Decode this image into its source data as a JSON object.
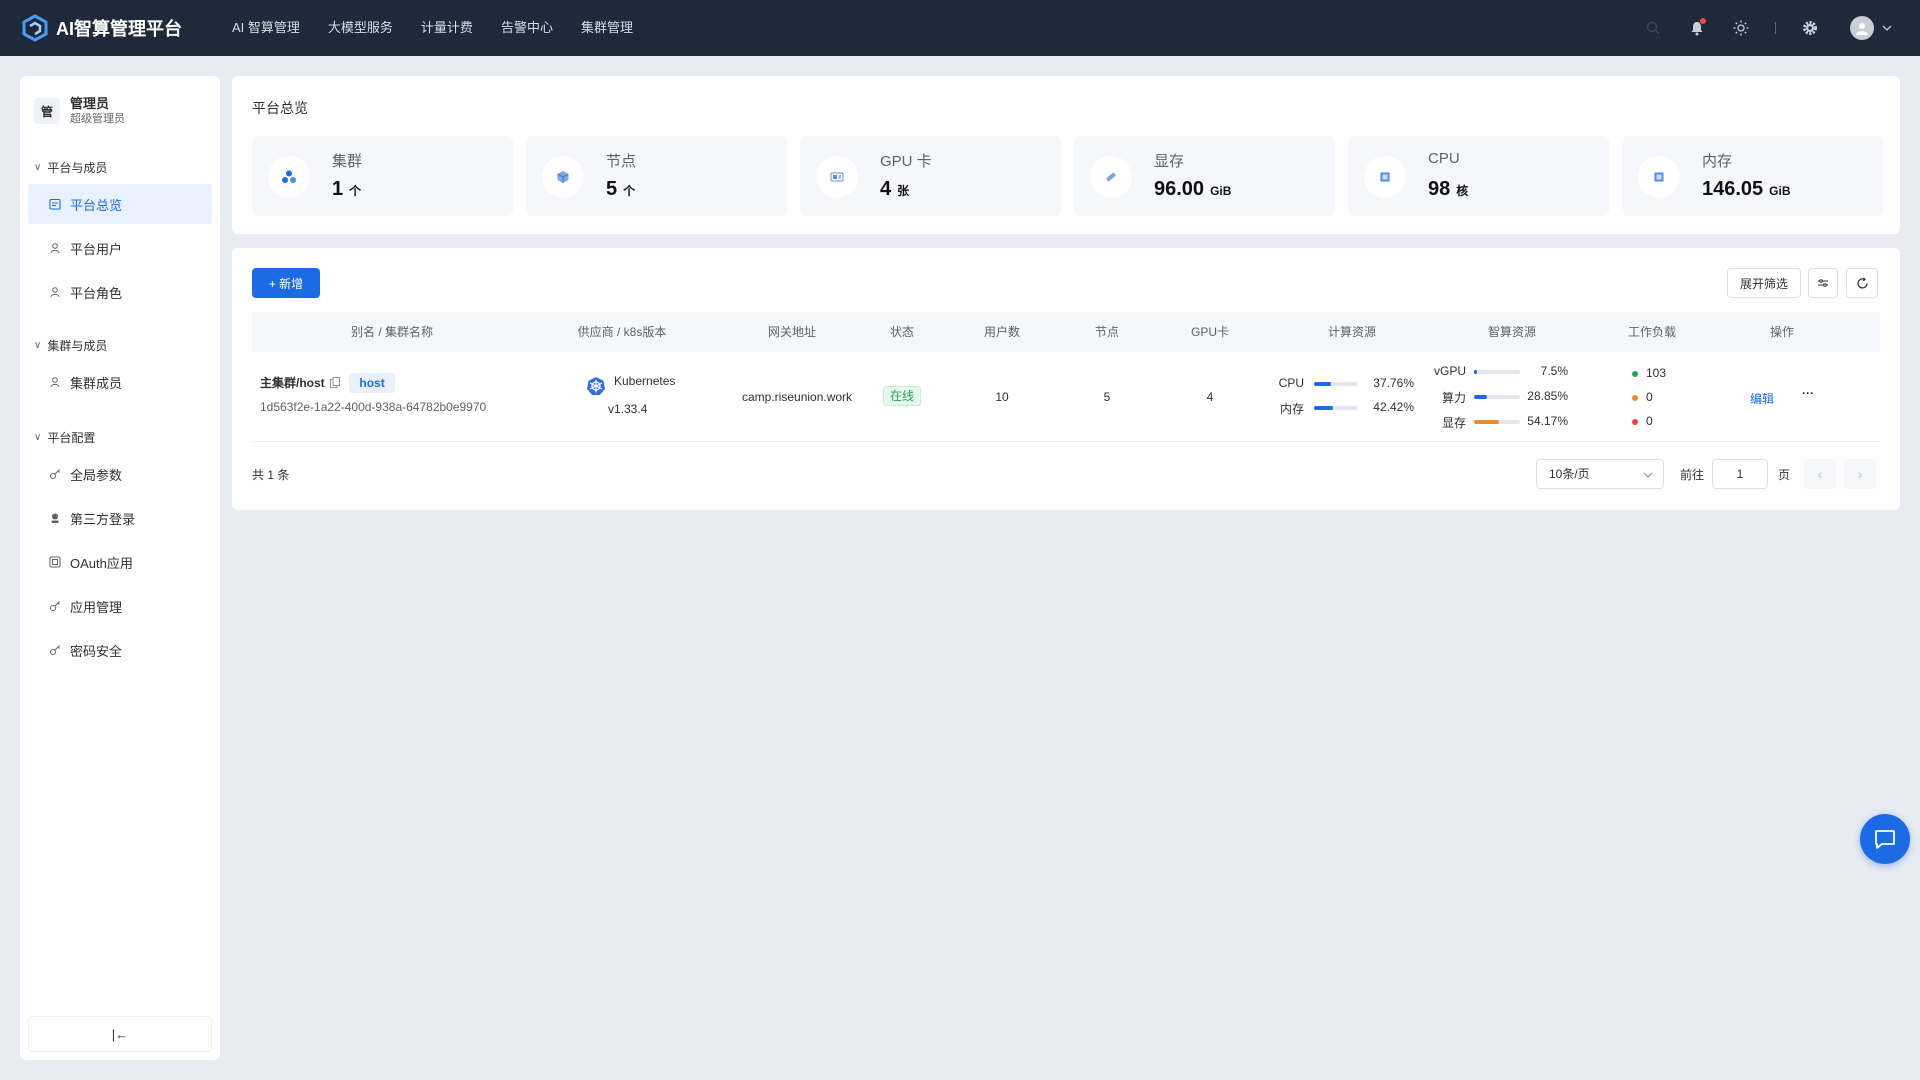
{
  "brand": {
    "title": "AI智算管理平台"
  },
  "topnav": [
    "AI 智算管理",
    "大模型服务",
    "计量计费",
    "告警中心",
    "集群管理"
  ],
  "colors": {
    "primary": "#1d6ae5",
    "topbar": "#1e2a3a",
    "green": "#2ba251",
    "orange": "#f0892c",
    "red": "#f04438"
  },
  "user": {
    "badge": "管",
    "name": "管理员",
    "role": "超级管理员"
  },
  "sidebar": {
    "groups": [
      {
        "label": "平台与成员",
        "items": [
          {
            "label": "平台总览",
            "icon": "dashboard-icon",
            "active": true
          },
          {
            "label": "平台用户",
            "icon": "user-icon"
          },
          {
            "label": "平台角色",
            "icon": "role-icon"
          }
        ]
      },
      {
        "label": "集群与成员",
        "items": [
          {
            "label": "集群成员",
            "icon": "user-icon"
          }
        ]
      },
      {
        "label": "平台配置",
        "items": [
          {
            "label": "全局参数",
            "icon": "key-icon"
          },
          {
            "label": "第三方登录",
            "icon": "login-icon"
          },
          {
            "label": "OAuth应用",
            "icon": "app-icon"
          },
          {
            "label": "应用管理",
            "icon": "key-icon"
          },
          {
            "label": "密码安全",
            "icon": "key-icon"
          }
        ]
      }
    ],
    "collapse_label": "|←"
  },
  "overview": {
    "title": "平台总览",
    "stats": [
      {
        "label": "集群",
        "value": "1",
        "unit": "个",
        "icon": "cluster-icon"
      },
      {
        "label": "节点",
        "value": "5",
        "unit": "个",
        "icon": "node-icon"
      },
      {
        "label": "GPU 卡",
        "value": "4",
        "unit": "张",
        "icon": "gpu-icon"
      },
      {
        "label": "显存",
        "value": "96.00",
        "unit": "GiB",
        "icon": "memory-icon"
      },
      {
        "label": "CPU",
        "value": "98",
        "unit": "核",
        "icon": "cpu-icon"
      },
      {
        "label": "内存",
        "value": "146.05",
        "unit": "GiB",
        "icon": "ram-icon"
      }
    ]
  },
  "table": {
    "add_label": "+ 新增",
    "filter_label": "展开筛选",
    "columns": [
      "别名 / 集群名称",
      "供应商 / k8s版本",
      "网关地址",
      "状态",
      "用户数",
      "节点",
      "GPU卡",
      "计算资源",
      "智算资源",
      "工作负载",
      "操作"
    ],
    "rows": [
      {
        "name": "主集群/host",
        "tag": "host",
        "id": "1d563f2e-1a22-400d-938a-64782b0e9970",
        "vendor": "Kubernetes",
        "version": "v1.33.4",
        "gateway": "camp.riseunion.work",
        "status": "在线",
        "users": "10",
        "nodes": "5",
        "gpus": "4",
        "compute": [
          {
            "label": "CPU",
            "pct": 37.76,
            "text": "37.76%"
          },
          {
            "label": "内存",
            "pct": 42.42,
            "text": "42.42%"
          }
        ],
        "ai": [
          {
            "label": "vGPU",
            "pct": 7.5,
            "text": "7.5%"
          },
          {
            "label": "算力",
            "pct": 28.85,
            "text": "28.85%"
          },
          {
            "label": "显存",
            "pct": 54.17,
            "text": "54.17%"
          }
        ],
        "workloads": [
          {
            "value": "103",
            "status": "running"
          },
          {
            "value": "0",
            "status": "pending"
          },
          {
            "value": "0",
            "status": "failed"
          }
        ],
        "edit_label": "编辑",
        "more_label": "···"
      }
    ]
  },
  "pagination": {
    "total": "共 1 条",
    "page_size": "10条/页",
    "goto_label": "前往",
    "page": "1",
    "page_suffix": "页"
  }
}
